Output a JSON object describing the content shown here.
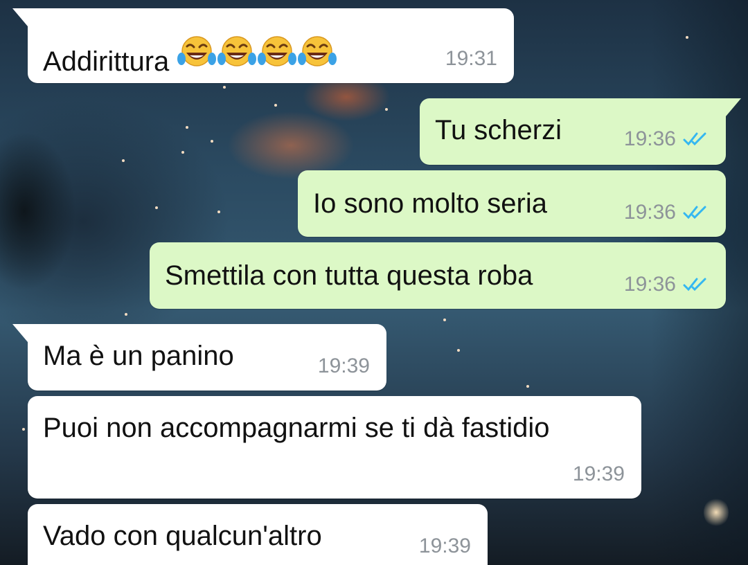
{
  "messages": [
    {
      "text": "Addiritturа",
      "time": "19:31",
      "direction": "incoming",
      "emoji": [
        "tears-of-joy-emoji",
        "tears-of-joy-emoji",
        "tears-of-joy-emoji",
        "tears-of-joy-emoji"
      ]
    },
    {
      "text": "Tu scherzi",
      "time": "19:36",
      "direction": "outgoing",
      "status": "read"
    },
    {
      "text": "Io sono molto seria",
      "time": "19:36",
      "direction": "outgoing",
      "status": "read"
    },
    {
      "text": "Smettila con tutta questa roba",
      "time": "19:36",
      "direction": "outgoing",
      "status": "read"
    },
    {
      "text": "Ma è un panino",
      "time": "19:39",
      "direction": "incoming"
    },
    {
      "text": "Puoi non accompagnarmi se ti dà fastidio",
      "time": "19:39",
      "direction": "incoming"
    },
    {
      "text": "Vado con qualcun'altro",
      "time": "19:39",
      "direction": "incoming"
    }
  ],
  "colors": {
    "incoming_bubble": "#ffffff",
    "outgoing_bubble": "#dcf8c6",
    "timestamp": "#8d9399",
    "read_ticks": "#34b7f1"
  }
}
